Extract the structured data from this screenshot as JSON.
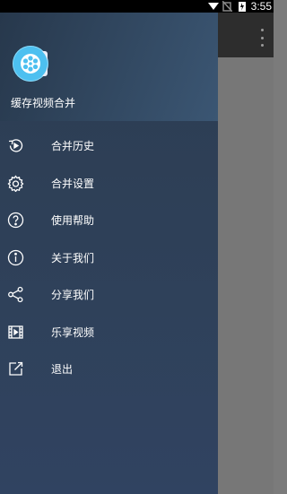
{
  "status_bar": {
    "time": "3:55"
  },
  "drawer": {
    "app_name": "缓存视频合并",
    "menu": [
      {
        "label": "合并历史",
        "icon": "history-play-icon"
      },
      {
        "label": "合并设置",
        "icon": "gear-icon"
      },
      {
        "label": "使用帮助",
        "icon": "help-icon"
      },
      {
        "label": "关于我们",
        "icon": "info-icon"
      },
      {
        "label": "分享我们",
        "icon": "share-icon"
      },
      {
        "label": "乐享视频",
        "icon": "film-icon"
      },
      {
        "label": "退出",
        "icon": "exit-icon"
      }
    ]
  },
  "colors": {
    "drawer_top": "#2c3d52",
    "drawer_bottom": "#304361",
    "app_bar": "#2d2d2d",
    "scrim": "#777777",
    "logo": "#4dc0f0"
  }
}
